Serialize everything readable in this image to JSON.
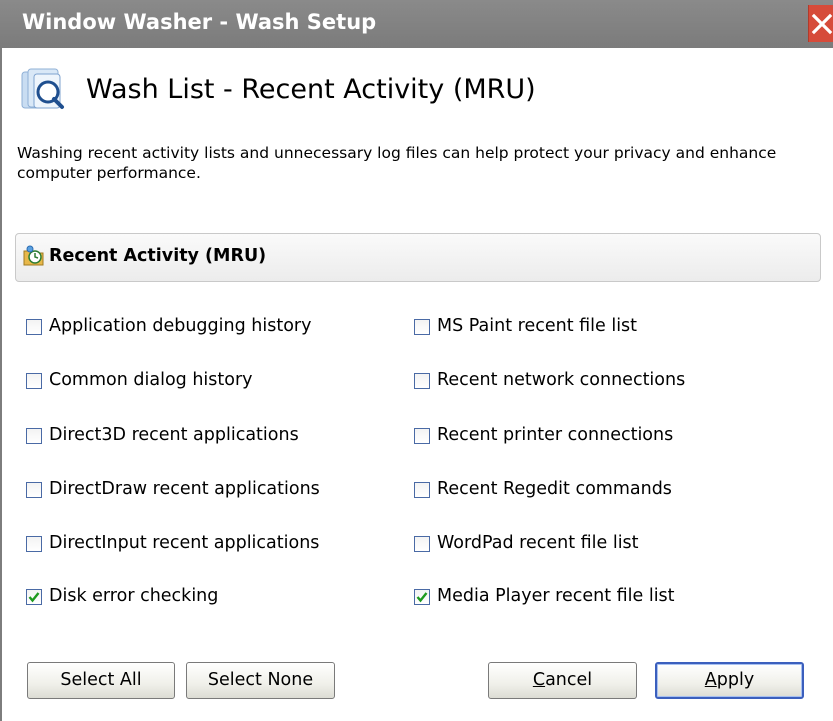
{
  "window": {
    "title": "Window Washer - Wash Setup"
  },
  "header": {
    "title": "Wash List - Recent Activity (MRU)",
    "icon": "wash-list-icon"
  },
  "description": "Washing recent activity lists and unnecessary log files can help protect your privacy and enhance computer performance.",
  "section": {
    "title": "Recent Activity (MRU)",
    "icon": "recent-activity-icon"
  },
  "left_items": [
    {
      "label": "Application debugging history",
      "checked": false
    },
    {
      "label": "Common dialog history",
      "checked": false
    },
    {
      "label": "Direct3D recent applications",
      "checked": false
    },
    {
      "label": "DirectDraw recent applications",
      "checked": false
    },
    {
      "label": "DirectInput recent applications",
      "checked": false
    },
    {
      "label": "Disk error checking",
      "checked": true
    }
  ],
  "right_items": [
    {
      "label": "MS Paint recent file list",
      "checked": false
    },
    {
      "label": "Recent network connections",
      "checked": false
    },
    {
      "label": "Recent printer connections",
      "checked": false
    },
    {
      "label": "Recent Regedit commands",
      "checked": false
    },
    {
      "label": "WordPad recent file list",
      "checked": false
    },
    {
      "label": "Media Player recent file list",
      "checked": true
    }
  ],
  "buttons": {
    "select_all": "Select All",
    "select_none": "Select None",
    "cancel_first": "C",
    "cancel_rest": "ancel",
    "apply_first": "A",
    "apply_rest": "pply"
  },
  "colors": {
    "title_bar": "#7f7f7f",
    "close_button": "#d64b3a",
    "checkbox_border": "#4a6aa5",
    "check_mark": "#1e9a1e",
    "default_button_border": "#3b5fbd"
  }
}
